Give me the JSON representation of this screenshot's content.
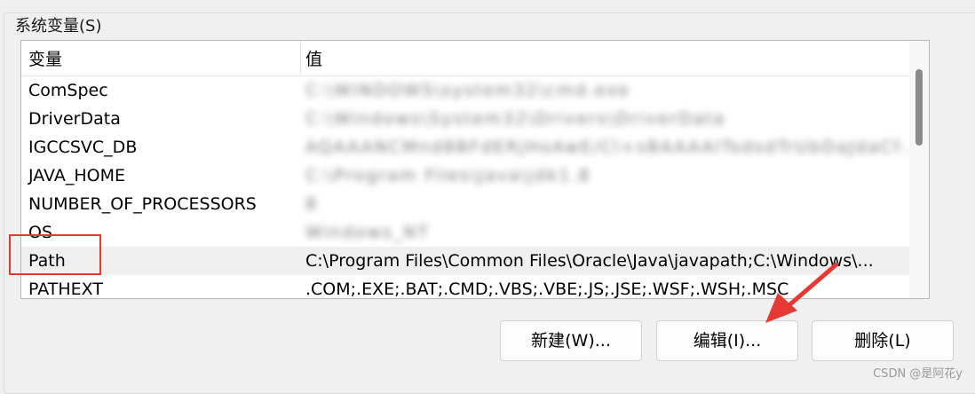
{
  "group": {
    "title": "系统变量(S)"
  },
  "table": {
    "headers": [
      "变量",
      "值"
    ],
    "rows": [
      {
        "name": "ComSpec",
        "value": "C:\\WINDOWS\\system32\\cmd.exe",
        "obscured": true
      },
      {
        "name": "DriverData",
        "value": "C:\\Windows\\System32\\Drivers\\DriverData",
        "obscured": true
      },
      {
        "name": "IGCCSVC_DB",
        "value": "AQAAANCMnd8BFdERjHoAwE/Cl+sBAAAAlTsdsdTrUbDaJdaCf...",
        "obscured": true
      },
      {
        "name": "JAVA_HOME",
        "value": "C:\\Program Files\\Java\\jdk1.8",
        "obscured": true
      },
      {
        "name": "NUMBER_OF_PROCESSORS",
        "value": "8",
        "obscured": true
      },
      {
        "name": "OS",
        "value": "Windows_NT",
        "obscured": true
      },
      {
        "name": "Path",
        "value": "C:\\Program Files\\Common Files\\Oracle\\Java\\javapath;C:\\Windows\\...",
        "obscured": false,
        "selected": true
      },
      {
        "name": "PATHEXT",
        "value": ".COM;.EXE;.BAT;.CMD;.VBS;.VBE;.JS;.JSE;.WSF;.WSH;.MSC",
        "obscured": false
      }
    ]
  },
  "buttons": {
    "new": "新建(W)...",
    "edit": "编辑(I)...",
    "delete": "删除(L)"
  },
  "watermark": "CSDN @是阿花y",
  "colors": {
    "annotation": "#e53935",
    "selected_row": "#efefef"
  }
}
